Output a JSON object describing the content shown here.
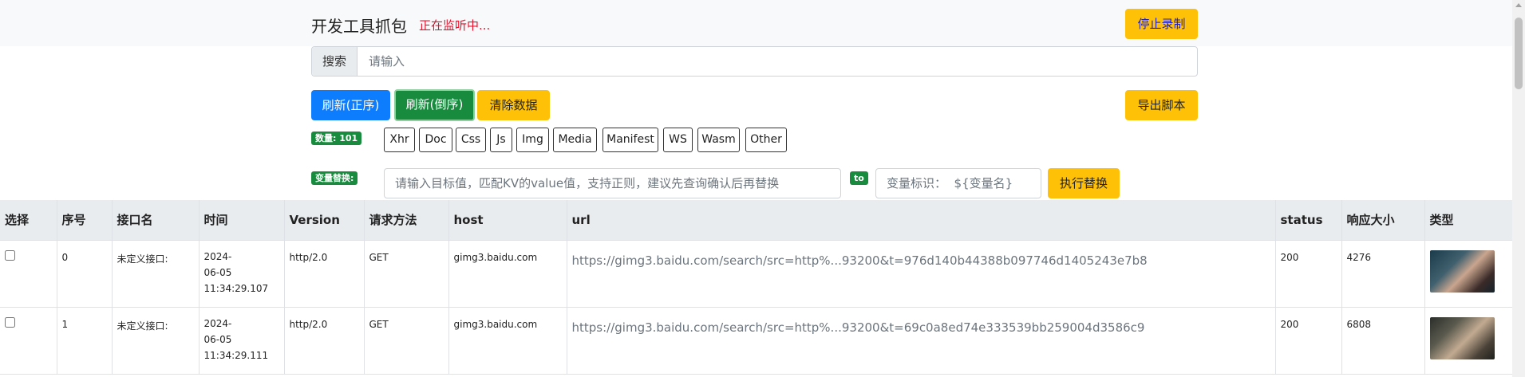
{
  "header": {
    "title": "开发工具抓包",
    "status": "正在监听中...",
    "stop_label": "停止录制"
  },
  "search": {
    "label": "搜索",
    "placeholder": "请输入"
  },
  "toolbar": {
    "refresh_asc": "刷新(正序)",
    "refresh_desc": "刷新(倒序)",
    "clear": "清除数据",
    "export": "导出脚本"
  },
  "count_badge": "数量: 101",
  "filters": [
    "Xhr",
    "Doc",
    "Css",
    "Js",
    "Img",
    "Media",
    "Manifest",
    "WS",
    "Wasm",
    "Other"
  ],
  "replace": {
    "badge": "变量替换:",
    "target_placeholder": "请输入目标值，匹配KV的value值，支持正则，建议先查询确认后再替换",
    "to": "to",
    "var_placeholder": "变量标识：  ${变量名}",
    "exec": "执行替换"
  },
  "table": {
    "columns": [
      "选择",
      "序号",
      "接口名",
      "时间",
      "Version",
      "请求方法",
      "host",
      "url",
      "status",
      "响应大小",
      "类型"
    ],
    "rows": [
      {
        "index": "0",
        "name": "未定义接口:",
        "date": "2024-",
        "date2": "06-05",
        "time": "11:34:29.107",
        "version": "http/2.0",
        "method": "GET",
        "host": "gimg3.baidu.com",
        "url": "https://gimg3.baidu.com/search/src=http%...93200&t=976d140b44388b097746d1405243e7b8",
        "status": "200",
        "size": "4276"
      },
      {
        "index": "1",
        "name": "未定义接口:",
        "date": "2024-",
        "date2": "06-05",
        "time": "11:34:29.111",
        "version": "http/2.0",
        "method": "GET",
        "host": "gimg3.baidu.com",
        "url": "https://gimg3.baidu.com/search/src=http%...93200&t=69c0a8ed74e333539bb259004d3586c9",
        "status": "200",
        "size": "6808"
      }
    ]
  }
}
